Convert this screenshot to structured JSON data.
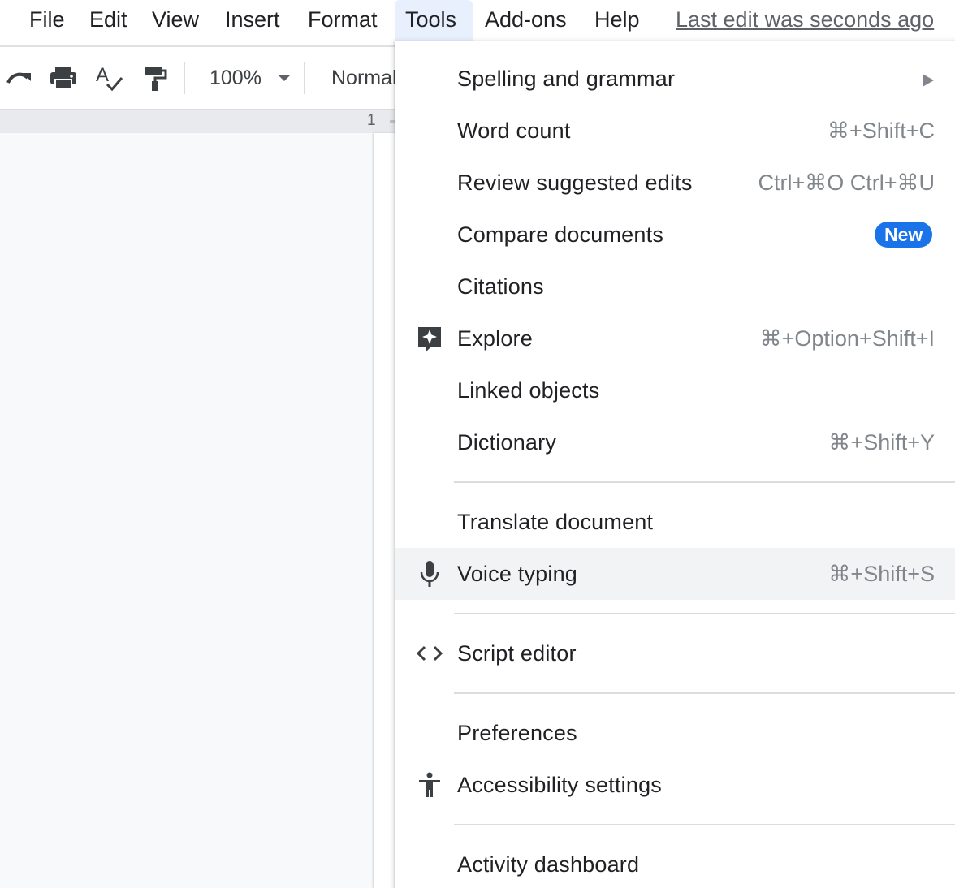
{
  "menubar": {
    "items": [
      {
        "label": "File"
      },
      {
        "label": "Edit"
      },
      {
        "label": "View"
      },
      {
        "label": "Insert"
      },
      {
        "label": "Format"
      },
      {
        "label": "Tools",
        "active": true
      },
      {
        "label": "Add-ons"
      },
      {
        "label": "Help"
      }
    ],
    "last_edit": "Last edit was seconds ago"
  },
  "toolbar": {
    "icons": [
      "redo-icon",
      "print-icon",
      "spellcheck-icon",
      "paint-format-icon"
    ],
    "zoom": "100%",
    "style": "Normal"
  },
  "ruler": {
    "number": "1"
  },
  "tools_menu": {
    "items": [
      {
        "label": "Spelling and grammar",
        "submenu": true
      },
      {
        "label": "Word count",
        "shortcut": "⌘+Shift+C"
      },
      {
        "label": "Review suggested edits",
        "shortcut": "Ctrl+⌘O Ctrl+⌘U"
      },
      {
        "label": "Compare documents",
        "badge": "New"
      },
      {
        "label": "Citations"
      },
      {
        "label": "Explore",
        "icon": "explore-icon",
        "shortcut": "⌘+Option+Shift+I"
      },
      {
        "label": "Linked objects"
      },
      {
        "label": "Dictionary",
        "shortcut": "⌘+Shift+Y"
      },
      {
        "label": "Translate document"
      },
      {
        "label": "Voice typing",
        "icon": "microphone-icon",
        "shortcut": "⌘+Shift+S",
        "highlighted": true
      },
      {
        "label": "Script editor",
        "icon": "code-icon"
      },
      {
        "label": "Preferences"
      },
      {
        "label": "Accessibility settings",
        "icon": "accessibility-icon"
      },
      {
        "label": "Activity dashboard"
      }
    ]
  },
  "colors": {
    "accent": "#1a73e8",
    "active_menu_bg": "#e8f0fe",
    "hover_bg": "#f1f3f4",
    "text": "#202124",
    "muted": "#80868b"
  }
}
